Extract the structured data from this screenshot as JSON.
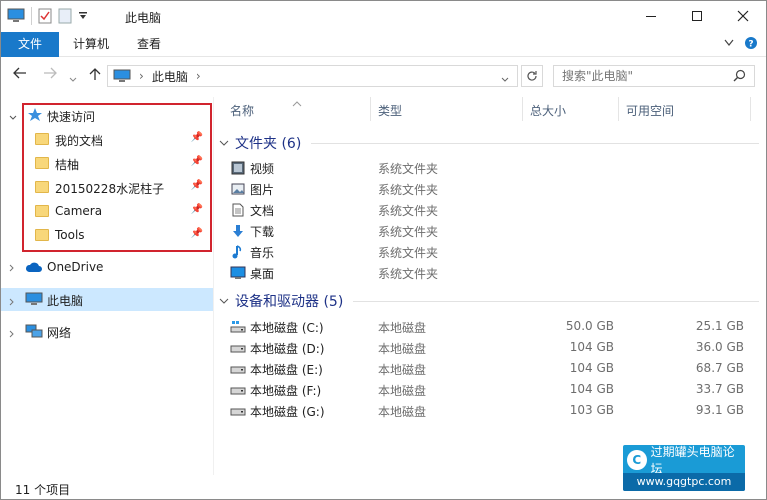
{
  "window": {
    "title": "此电脑"
  },
  "ribbon": {
    "tabs": [
      "文件",
      "计算机",
      "查看"
    ]
  },
  "address": {
    "path": [
      "此电脑"
    ]
  },
  "search": {
    "placeholder": "搜索\"此电脑\""
  },
  "nav": {
    "quick_access": {
      "label": "快速访问",
      "items": [
        "我的文档",
        "桔柚",
        "20150228水泥柱子",
        "Camera",
        "Tools"
      ]
    },
    "onedrive": "OneDrive",
    "this_pc": "此电脑",
    "network": "网络"
  },
  "columns": {
    "name": "名称",
    "type": "类型",
    "total": "总大小",
    "free": "可用空间"
  },
  "folders_group": {
    "label": "文件夹 (6)"
  },
  "folders": [
    {
      "name": "视频",
      "type": "系统文件夹",
      "icon": "video-icon"
    },
    {
      "name": "图片",
      "type": "系统文件夹",
      "icon": "pictures-icon"
    },
    {
      "name": "文档",
      "type": "系统文件夹",
      "icon": "documents-icon"
    },
    {
      "name": "下载",
      "type": "系统文件夹",
      "icon": "download-icon"
    },
    {
      "name": "音乐",
      "type": "系统文件夹",
      "icon": "music-icon"
    },
    {
      "name": "桌面",
      "type": "系统文件夹",
      "icon": "desktop-icon"
    }
  ],
  "drives_group": {
    "label": "设备和驱动器 (5)"
  },
  "drives": [
    {
      "name": "本地磁盘 (C:)",
      "type": "本地磁盘",
      "total": "50.0 GB",
      "free": "25.1 GB"
    },
    {
      "name": "本地磁盘 (D:)",
      "type": "本地磁盘",
      "total": "104 GB",
      "free": "36.0 GB"
    },
    {
      "name": "本地磁盘 (E:)",
      "type": "本地磁盘",
      "total": "104 GB",
      "free": "68.7 GB"
    },
    {
      "name": "本地磁盘 (F:)",
      "type": "本地磁盘",
      "total": "104 GB",
      "free": "33.7 GB"
    },
    {
      "name": "本地磁盘 (G:)",
      "type": "本地磁盘",
      "total": "103 GB",
      "free": "93.1 GB"
    }
  ],
  "status": {
    "count": "11 个项目"
  },
  "watermark": {
    "title": "过期罐头电脑论坛",
    "url": "www.gqgtpc.com"
  },
  "colors": {
    "accent": "#1979ca",
    "highlight_box": "#d1242e",
    "selection": "#cce8ff"
  }
}
